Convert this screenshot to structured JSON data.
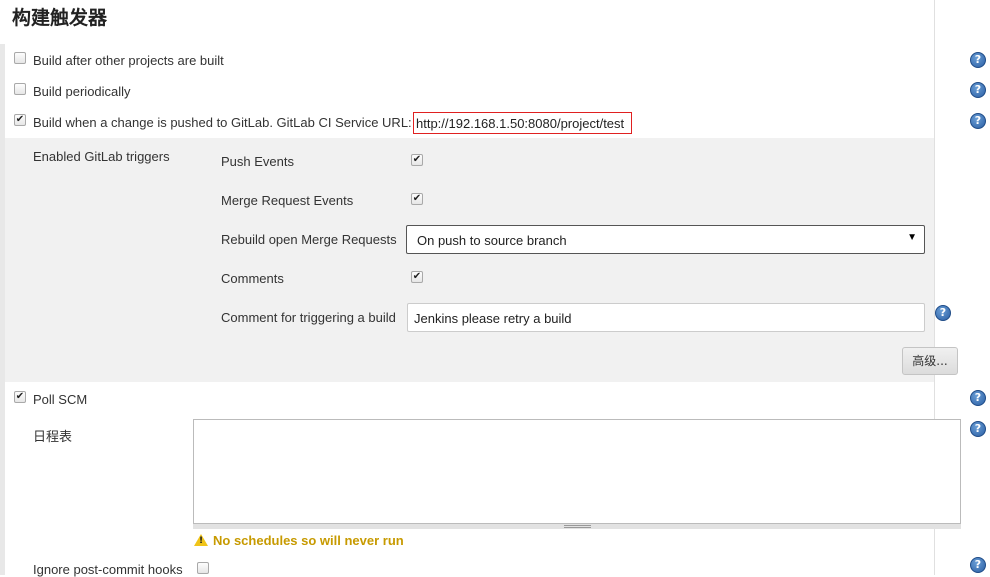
{
  "section_title": "构建触发器",
  "triggers": {
    "build_after_other": {
      "label": "Build after other projects are built",
      "checked": false
    },
    "build_periodically": {
      "label": "Build periodically",
      "checked": false
    },
    "gitlab_push": {
      "label": "Build when a change is pushed to GitLab. GitLab CI Service URL:",
      "url": "http://192.168.1.50:8080/project/test",
      "checked": true
    }
  },
  "gitlab_options": {
    "enabled_label": "Enabled GitLab triggers",
    "push_events": {
      "label": "Push Events",
      "checked": true
    },
    "merge_request_events": {
      "label": "Merge Request Events",
      "checked": true
    },
    "rebuild_open_mr": {
      "label": "Rebuild open Merge Requests",
      "selected": "On push to source branch"
    },
    "comments": {
      "label": "Comments",
      "checked": true
    },
    "comment_trigger": {
      "label": "Comment for triggering a build",
      "value": "Jenkins please retry a build"
    },
    "advanced_button": "高级..."
  },
  "poll_scm": {
    "label": "Poll SCM",
    "checked": true,
    "schedule_label": "日程表",
    "schedule_value": "",
    "warning": "No schedules so will never run"
  },
  "ignore_post_commit": {
    "label": "Ignore post-commit hooks",
    "checked": false
  },
  "icons": {
    "help": "help-icon",
    "check": "checkmark-icon",
    "warning": "warning-icon",
    "dropdown": "chevron-down-icon"
  },
  "colors": {
    "url_border": "#e02020",
    "warning_text": "#c79a00",
    "help_icon": "#2a5ea3",
    "panel_bg": "#f1f1f1"
  }
}
